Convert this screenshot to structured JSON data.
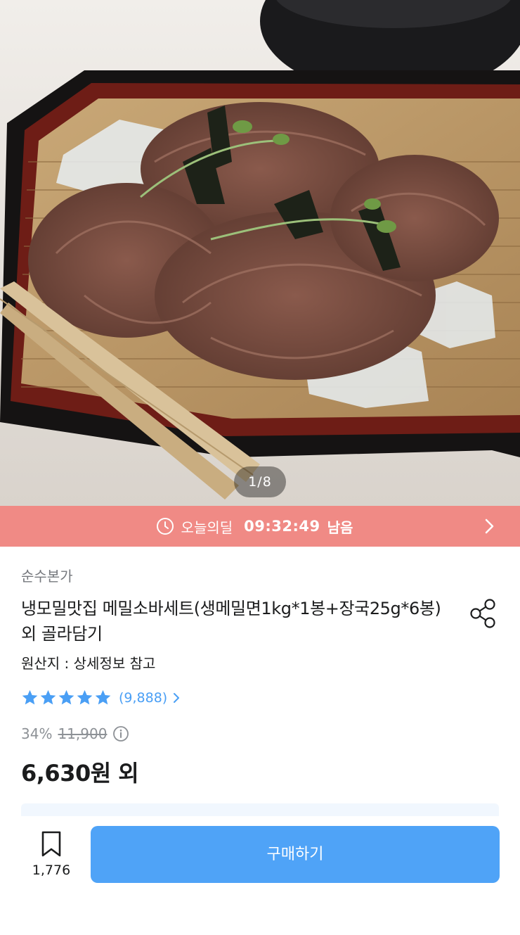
{
  "gallery": {
    "counter": "1/8"
  },
  "deal_banner": {
    "label": "오늘의딜",
    "countdown": "09:32:49",
    "remaining_suffix": "남음",
    "bg_color": "#f08a85"
  },
  "product": {
    "brand": "순수본가",
    "title": "냉모밀맛집 메밀소바세트(생메밀면1kg*1봉+장국25g*6봉)  외 골라담기",
    "origin": "원산지 : 상세정보 참고",
    "rating": {
      "stars": 5,
      "review_count": "(9,888)"
    },
    "discount_rate": "34%",
    "original_price": "11,900",
    "sale_price": "6,630원 외"
  },
  "bottom_bar": {
    "bookmark_count": "1,776",
    "buy_label": "구매하기",
    "accent_color": "#4fa3f7"
  }
}
